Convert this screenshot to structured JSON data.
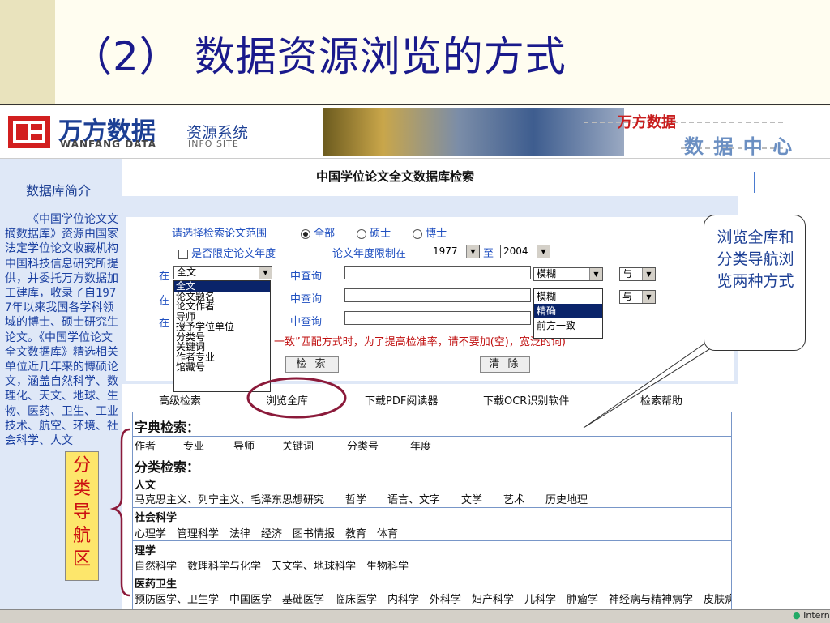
{
  "slide": {
    "title": "（2） 数据资源浏览的方式"
  },
  "header": {
    "logo_cn": "万方数据",
    "logo_en": "WANFANG DATA",
    "system_cn": "资源系统",
    "system_en": "INFO SITE",
    "brand_top": "万方数据",
    "brand_bottom": "数 据 中 心"
  },
  "sidebar": {
    "title": "数据库简介",
    "text": "《中国学位论文文摘数据库》资源由国家法定学位论文收藏机构中国科技信息研究所提供，并委托万方数据加工建库，收录了自1977年以来我国各学科领域的博士、硕士研究生论文。《中国学位论文全文数据库》精选相关单位近几年来的博硕论文，涵盖自然科学、数理化、天文、地球、生物、医药、卫生、工业技术、航空、环境、社会科学、人文"
  },
  "main": {
    "title": "中国学位论文全文数据库检索",
    "scope_label": "请选择检索论文范围",
    "scope_options": [
      "全部",
      "硕士",
      "博士"
    ],
    "year_limit_label": "是否限定论文年度",
    "year_range_label": "论文年度限制在",
    "year_from": "1977",
    "year_to_label": "至",
    "year_to": "2004",
    "row_prefix": "在",
    "row_query_label": "中查询",
    "field_selected": "全文",
    "match_selected": "模糊",
    "logic_selected": "与",
    "hint": "一致”匹配方式时，为了提高检准率，请不要加(空)，宽泛的词)",
    "search_button": "检 索",
    "clear_button": "清 除",
    "field_options": [
      "全文",
      "论文题名",
      "论文作者",
      "导师",
      "授予学位单位",
      "分类号",
      "关键词",
      "作者专业",
      "馆藏号"
    ],
    "match_options": [
      "模糊",
      "精确",
      "前方一致"
    ]
  },
  "nav": {
    "items": [
      "高级检索",
      "浏览全库",
      "下载PDF阅读器",
      "下载OCR识别软件",
      "检索帮助"
    ]
  },
  "dict": {
    "title": "字典检索：",
    "items": [
      "作者",
      "专业",
      "导师",
      "关键词",
      "分类号",
      "年度"
    ]
  },
  "classify": {
    "title": "分类检索：",
    "groups": [
      {
        "name": "人文",
        "items": "马克思主义、列宁主义、毛泽东思想研究　　哲学　　语言、文字　　文学　　艺术　　历史地理"
      },
      {
        "name": "社会科学",
        "items": "心理学　管理科学　法律　经济　图书情报　教育　体育"
      },
      {
        "name": "理学",
        "items": "自然科学　数理科学与化学　天文学、地球科学　生物科学"
      },
      {
        "name": "医药卫生",
        "items": "预防医学、卫生学　中国医学　基础医学　临床医学　内科学　外科学　妇产科学　儿科学　肿瘤学　神经病与精神病学　皮肤病与性病学　耳鼻咽喉科学　眼科学　口腔科学　特种医学　药学"
      }
    ]
  },
  "annotations": {
    "callout": "浏览全库和分类导航浏览两种方式",
    "classify_nav": "分类导航区"
  },
  "statusbar": {
    "zone": "Interne"
  },
  "colors": {
    "title": "#1a1a8c",
    "link_blue": "#2050c0",
    "panel": "#dfe8f7",
    "ellipse": "#8b1a3a"
  }
}
